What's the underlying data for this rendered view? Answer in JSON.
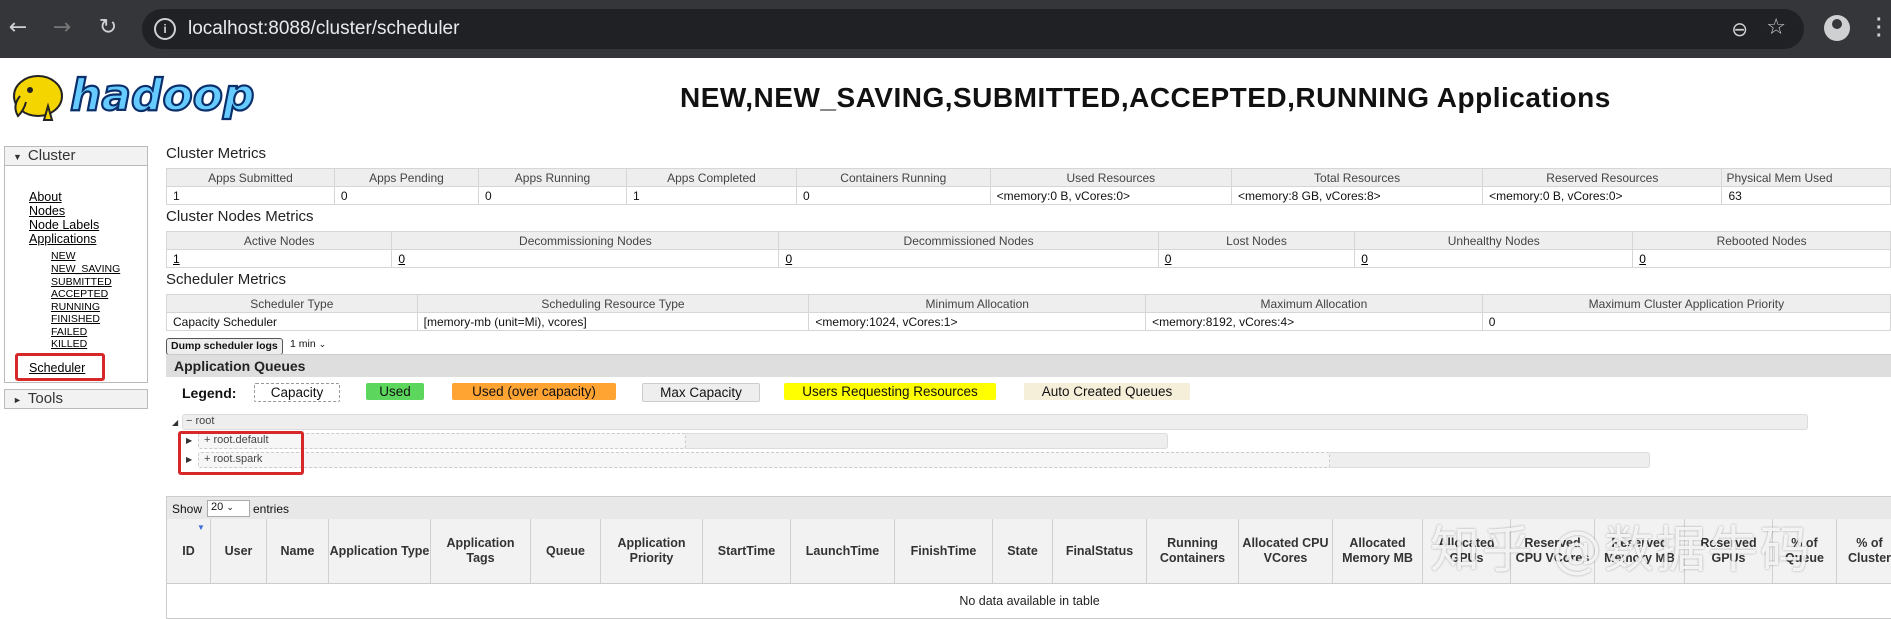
{
  "browser": {
    "url": "localhost:8088/cluster/scheduler",
    "back_icon": "←",
    "forward_icon": "→",
    "reload_icon": "↻",
    "zoom_icon": "⊖",
    "star_icon": "☆"
  },
  "logo_text": "hadoop",
  "page_title": "NEW,NEW_SAVING,SUBMITTED,ACCEPTED,RUNNING Applications",
  "sidebar": {
    "cluster_label": "Cluster",
    "links": [
      "About",
      "Nodes",
      "Node Labels",
      "Applications"
    ],
    "app_states": [
      "NEW",
      "NEW_SAVING",
      "SUBMITTED",
      "ACCEPTED",
      "RUNNING",
      "FINISHED",
      "FAILED",
      "KILLED"
    ],
    "scheduler_label": "Scheduler",
    "tools_label": "Tools"
  },
  "cluster_metrics": {
    "title": "Cluster Metrics",
    "headers": [
      "Apps Submitted",
      "Apps Pending",
      "Apps Running",
      "Apps Completed",
      "Containers Running",
      "Used Resources",
      "Total Resources",
      "Reserved Resources",
      "Physical Mem Used"
    ],
    "values": [
      "1",
      "0",
      "0",
      "1",
      "0",
      "<memory:0 B, vCores:0>",
      "<memory:8 GB, vCores:8>",
      "<memory:0 B, vCores:0>",
      "63"
    ]
  },
  "nodes_metrics": {
    "title": "Cluster Nodes Metrics",
    "headers": [
      "Active Nodes",
      "Decommissioning Nodes",
      "Decommissioned Nodes",
      "Lost Nodes",
      "Unhealthy Nodes",
      "Rebooted Nodes"
    ],
    "values": [
      "1",
      "0",
      "0",
      "0",
      "0",
      "0"
    ]
  },
  "scheduler_metrics": {
    "title": "Scheduler Metrics",
    "headers": [
      "Scheduler Type",
      "Scheduling Resource Type",
      "Minimum Allocation",
      "Maximum Allocation",
      "Maximum Cluster Application Priority"
    ],
    "values": [
      "Capacity Scheduler",
      "[memory-mb (unit=Mi), vcores]",
      "<memory:1024, vCores:1>",
      "<memory:8192, vCores:4>",
      "0"
    ]
  },
  "dump": {
    "button": "Dump scheduler logs",
    "interval": "1 min"
  },
  "queues": {
    "header": "Application Queues",
    "legend_label": "Legend:",
    "legend": [
      {
        "label": "Capacity",
        "bg": "#ffffff",
        "border": "#999"
      },
      {
        "label": "Used",
        "bg": "#5cd65c",
        "border": "#5cd65c"
      },
      {
        "label": "Used (over capacity)",
        "bg": "#ffa333",
        "border": "#ffa333"
      },
      {
        "label": "Max Capacity",
        "bg": "#eeeeee",
        "border": "#ccc"
      },
      {
        "label": "Users Requesting Resources",
        "bg": "#ffff00",
        "border": "#ffff00"
      },
      {
        "label": "Auto Created Queues",
        "bg": "#f5eed8",
        "border": "#f5eed8"
      }
    ],
    "items": [
      {
        "label": "root",
        "prefix": "−"
      },
      {
        "label": "root.default",
        "prefix": "+"
      },
      {
        "label": "root.spark",
        "prefix": "+"
      }
    ]
  },
  "apps_table": {
    "show": "Show",
    "page_size": "20",
    "entries": "entries",
    "columns": [
      "ID",
      "User",
      "Name",
      "Application Type",
      "Application Tags",
      "Queue",
      "Application Priority",
      "StartTime",
      "LaunchTime",
      "FinishTime",
      "State",
      "FinalStatus",
      "Running Containers",
      "Allocated CPU VCores",
      "Allocated Memory MB",
      "Allocated GPUs",
      "Reserved CPU VCores",
      "Reserved Memory MB",
      "Reserved GPUs",
      "% of Queue",
      "% of Cluster"
    ],
    "empty_text": "No data available in table"
  },
  "watermark": "知乎 @数据牛码"
}
